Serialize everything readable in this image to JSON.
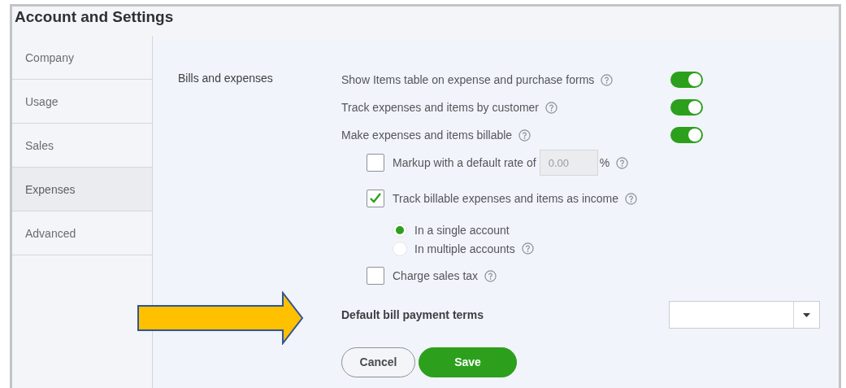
{
  "title": "Account and Settings",
  "sidebar": {
    "items": [
      {
        "label": "Company",
        "selected": false
      },
      {
        "label": "Usage",
        "selected": false
      },
      {
        "label": "Sales",
        "selected": false
      },
      {
        "label": "Expenses",
        "selected": true
      },
      {
        "label": "Advanced",
        "selected": false
      }
    ]
  },
  "section": {
    "label": "Bills and expenses",
    "toggles": [
      {
        "label": "Show Items table on expense and purchase forms",
        "on": true
      },
      {
        "label": "Track expenses and items by customer",
        "on": true
      },
      {
        "label": "Make expenses and items billable",
        "on": true
      }
    ],
    "markup": {
      "label": "Markup with a default rate of",
      "checked": false,
      "value": "0.00",
      "suffix": "%"
    },
    "track_income": {
      "label": "Track billable expenses and items as income",
      "checked": true,
      "radios": [
        {
          "label": "In a single account",
          "selected": true,
          "help": false
        },
        {
          "label": "In multiple accounts",
          "selected": false,
          "help": true
        }
      ]
    },
    "sales_tax": {
      "label": "Charge sales tax",
      "checked": false
    },
    "payment_terms": {
      "label": "Default bill payment terms"
    }
  },
  "buttons": [
    {
      "label": "Cancel",
      "kind": "secondary"
    },
    {
      "label": "Save",
      "kind": "primary"
    }
  ]
}
